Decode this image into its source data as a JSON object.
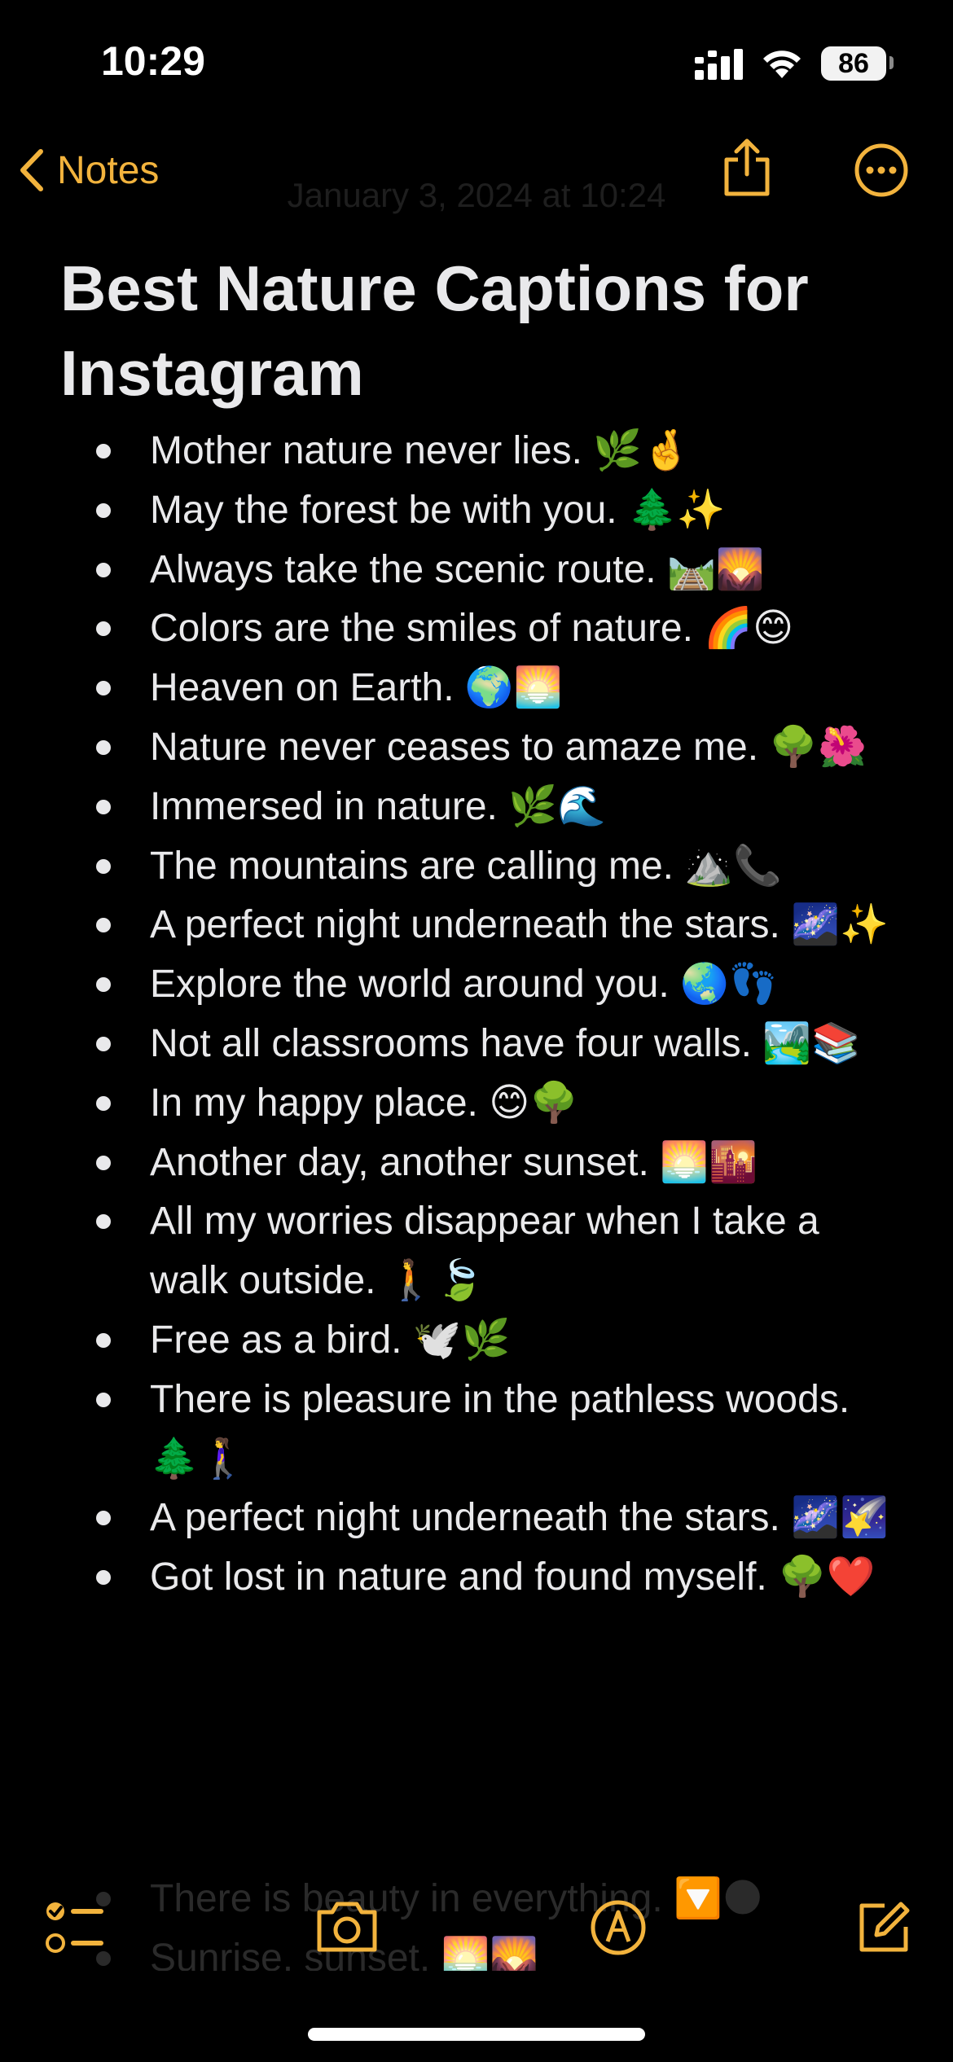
{
  "status_bar": {
    "time": "10:29",
    "battery": "86"
  },
  "nav": {
    "back_label": "Notes"
  },
  "note": {
    "date": "January 3, 2024 at 10:24",
    "title": "Best Nature Captions for Instagram",
    "items": [
      "Mother nature never lies. 🌿🤞",
      "May the forest be with you. 🌲✨",
      "Always take the scenic route. 🛤️🌄",
      "Colors are the smiles of nature. 🌈😊",
      "Heaven on Earth. 🌍🌅",
      "Nature never ceases to amaze me. 🌳🌺",
      "Immersed in nature. 🌿🌊",
      "The mountains are calling me. ⛰️📞",
      "A perfect night underneath the stars. 🌌✨",
      "Explore the world around you. 🌏👣",
      "Not all classrooms have four walls. 🏞️📚",
      "In my happy place. 😊🌳",
      "Another day, another sunset. 🌅🌇",
      "All my worries disappear when I take a walk outside. 🚶🍃",
      "Free as a bird. 🕊️🌿",
      "There is pleasure in the pathless woods. 🌲🚶‍♀️",
      "A perfect night underneath the stars. 🌌🌠",
      "Got lost in nature and found myself. 🌳❤️"
    ],
    "faded_items": [
      "There is beauty in everything. 🔽🌑",
      "Sunrise, sunset. 🌅🌄"
    ]
  },
  "colors": {
    "accent": "#f2b33d",
    "background": "#000000",
    "text": "#e9e9eb"
  },
  "icons": {
    "back": "chevron-left-icon",
    "share": "share-icon",
    "more": "ellipsis-circle-icon",
    "checklist": "checklist-icon",
    "camera": "camera-icon",
    "markup": "markup-pen-icon",
    "compose": "compose-icon"
  }
}
